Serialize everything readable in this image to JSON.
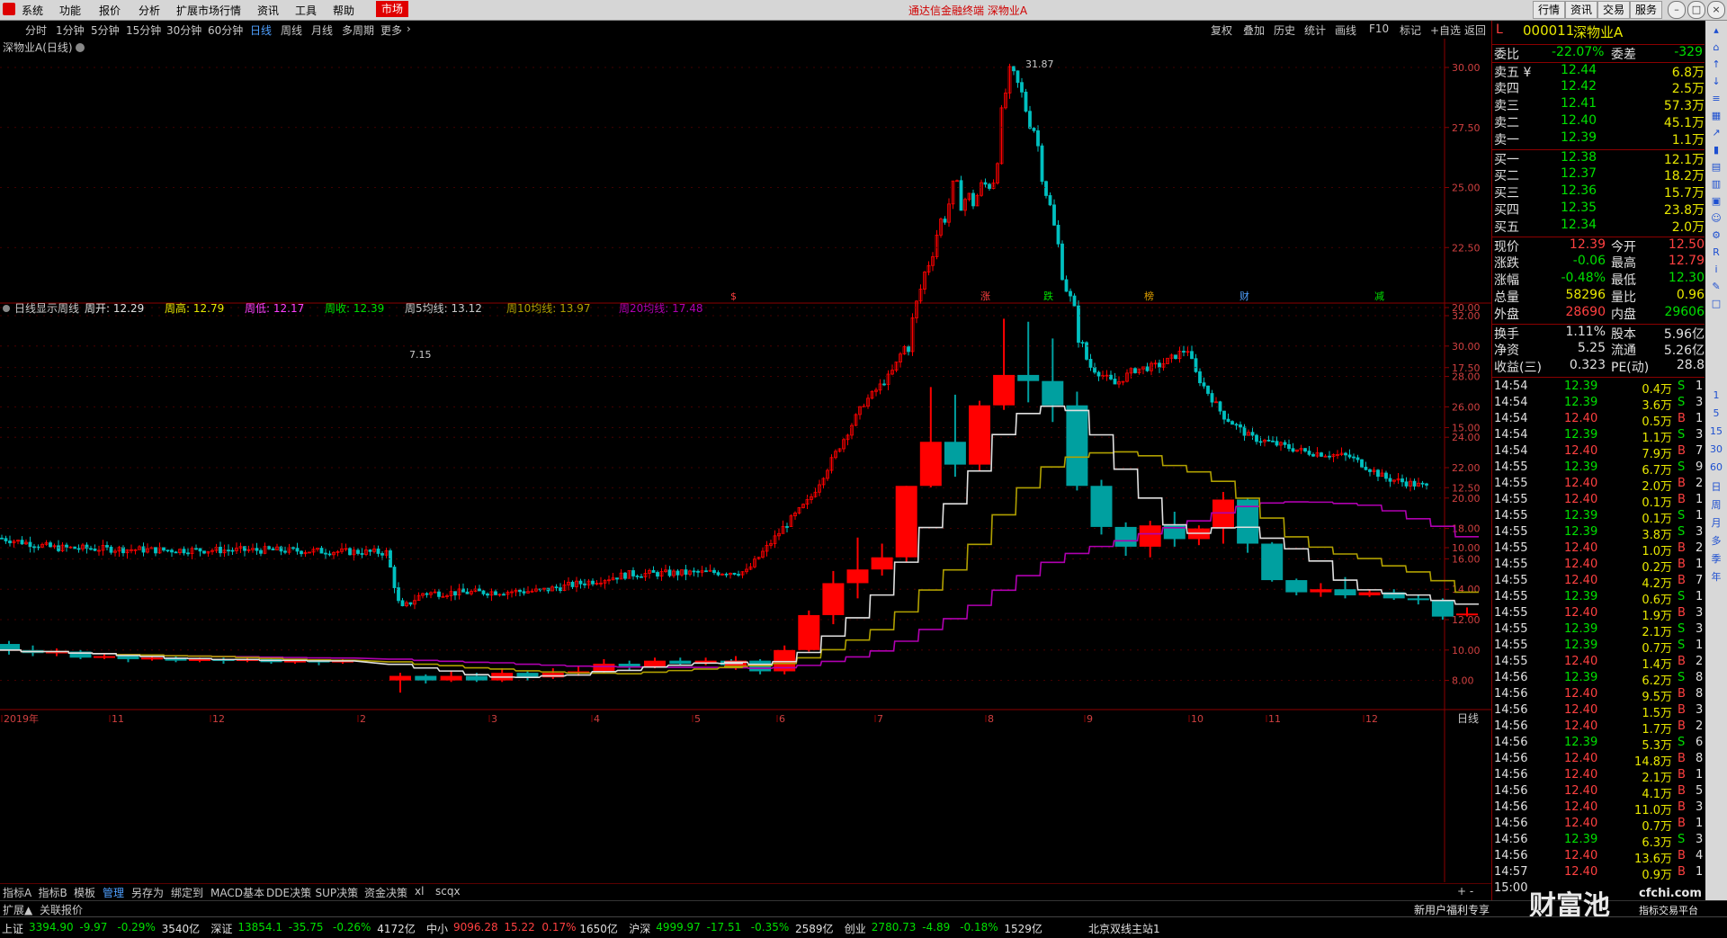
{
  "menubar": {
    "items": [
      "系统",
      "功能",
      "报价",
      "分析",
      "扩展市场行情",
      "资讯",
      "工具",
      "帮助"
    ],
    "market": "市场",
    "app_title": "通达信金融终端  深物业A",
    "right_buttons": [
      "行情",
      "资讯",
      "交易",
      "服务"
    ]
  },
  "toolbar": {
    "periods": [
      "分时",
      "1分钟",
      "5分钟",
      "15分钟",
      "30分钟",
      "60分钟",
      "日线",
      "周线",
      "月线",
      "多周期",
      "更多"
    ],
    "active": "日线",
    "right_items": [
      "复权",
      "叠加",
      "历史",
      "统计",
      "画线",
      "F10",
      "标记",
      "+自选",
      "返回"
    ]
  },
  "main_chart": {
    "title": "深物业A(日线)",
    "high_label": "31.87",
    "low_label": "7.15",
    "y_ticks": [
      "30.00",
      "27.50",
      "25.00",
      "22.50",
      "20.00",
      "17.50",
      "15.00",
      "12.50",
      "10.00"
    ],
    "markers": [
      "$",
      "涨",
      "跌",
      "榜",
      "财",
      "减"
    ]
  },
  "sub_chart": {
    "legend": [
      {
        "label": "日线显示周线",
        "value": "",
        "color": "#c8c8c8"
      },
      {
        "label": "周开: ",
        "value": "12.29",
        "color": "#e0e0e0"
      },
      {
        "label": "周高: ",
        "value": "12.79",
        "color": "#e8e800"
      },
      {
        "label": "周低: ",
        "value": "12.17",
        "color": "#ff40ff"
      },
      {
        "label": "周收: ",
        "value": "12.39",
        "color": "#00e000"
      },
      {
        "label": "周5均线: ",
        "value": "13.12",
        "color": "#c8c8c8"
      },
      {
        "label": "周10均线: ",
        "value": "13.97",
        "color": "#b0a000"
      },
      {
        "label": "周20均线: ",
        "value": "17.48",
        "color": "#b000b0"
      }
    ],
    "y_ticks": [
      "32.00",
      "30.00",
      "28.00",
      "26.00",
      "24.00",
      "22.00",
      "20.00",
      "18.00",
      "16.00",
      "14.00",
      "12.00",
      "10.00",
      "8.00"
    ],
    "x_labels": [
      "2019年",
      "11",
      "12",
      "2",
      "3",
      "4",
      "5",
      "6",
      "7",
      "8",
      "9",
      "10",
      "11",
      "12"
    ],
    "x_range_label": "日线"
  },
  "quote": {
    "code": "000011",
    "name": "深物业A",
    "weibi_label": "委比",
    "weibi": "-22.07%",
    "weicha_label": "委差",
    "weicha": "-329",
    "sells": [
      {
        "label": "卖五 ¥",
        "price": "12.44",
        "vol": "6.8万"
      },
      {
        "label": "卖四",
        "price": "12.42",
        "vol": "2.5万"
      },
      {
        "label": "卖三",
        "price": "12.41",
        "vol": "57.3万"
      },
      {
        "label": "卖二",
        "price": "12.40",
        "vol": "45.1万"
      },
      {
        "label": "卖一",
        "price": "12.39",
        "vol": "1.1万"
      }
    ],
    "buys": [
      {
        "label": "买一",
        "price": "12.38",
        "vol": "12.1万"
      },
      {
        "label": "买二",
        "price": "12.37",
        "vol": "18.2万"
      },
      {
        "label": "买三",
        "price": "12.36",
        "vol": "15.7万"
      },
      {
        "label": "买四",
        "price": "12.35",
        "vol": "23.8万"
      },
      {
        "label": "买五",
        "price": "12.34",
        "vol": "2.0万"
      }
    ],
    "stats": [
      {
        "l1": "现价",
        "v1": "12.39",
        "c1": "red",
        "l2": "今开",
        "v2": "12.50",
        "c2": "red"
      },
      {
        "l1": "涨跌",
        "v1": "-0.06",
        "c1": "green",
        "l2": "最高",
        "v2": "12.79",
        "c2": "red"
      },
      {
        "l1": "涨幅",
        "v1": "-0.48%",
        "c1": "green",
        "l2": "最低",
        "v2": "12.30",
        "c2": "green"
      },
      {
        "l1": "总量",
        "v1": "58296",
        "c1": "yellow",
        "l2": "量比",
        "v2": "0.96",
        "c2": "yellow"
      },
      {
        "l1": "外盘",
        "v1": "28690",
        "c1": "red",
        "l2": "内盘",
        "v2": "29606",
        "c2": "green"
      }
    ],
    "stats2": [
      {
        "l1": "换手",
        "v1": "1.11%",
        "l2": "股本",
        "v2": "5.96亿"
      },
      {
        "l1": "净资",
        "v1": "5.25",
        "l2": "流通",
        "v2": "5.26亿"
      },
      {
        "l1": "收益(三)",
        "v1": "0.323",
        "l2": "PE(动)",
        "v2": "28.8"
      }
    ],
    "ticks": [
      [
        "14:54",
        "12.39",
        "0.4万",
        "S",
        "1"
      ],
      [
        "14:54",
        "12.39",
        "3.6万",
        "S",
        "3"
      ],
      [
        "14:54",
        "12.40",
        "0.5万",
        "B",
        "1"
      ],
      [
        "14:54",
        "12.39",
        "1.1万",
        "S",
        "3"
      ],
      [
        "14:54",
        "12.40",
        "7.9万",
        "B",
        "7"
      ],
      [
        "14:55",
        "12.39",
        "6.7万",
        "S",
        "9"
      ],
      [
        "14:55",
        "12.40",
        "2.0万",
        "B",
        "2"
      ],
      [
        "14:55",
        "12.40",
        "0.1万",
        "B",
        "1"
      ],
      [
        "14:55",
        "12.39",
        "0.1万",
        "S",
        "1"
      ],
      [
        "14:55",
        "12.39",
        "3.8万",
        "S",
        "3"
      ],
      [
        "14:55",
        "12.40",
        "1.0万",
        "B",
        "2"
      ],
      [
        "14:55",
        "12.40",
        "0.2万",
        "B",
        "1"
      ],
      [
        "14:55",
        "12.40",
        "4.2万",
        "B",
        "7"
      ],
      [
        "14:55",
        "12.39",
        "0.6万",
        "S",
        "1"
      ],
      [
        "14:55",
        "12.40",
        "1.9万",
        "B",
        "3"
      ],
      [
        "14:55",
        "12.39",
        "2.1万",
        "S",
        "3"
      ],
      [
        "14:55",
        "12.39",
        "0.7万",
        "S",
        "1"
      ],
      [
        "14:55",
        "12.40",
        "1.4万",
        "B",
        "2"
      ],
      [
        "14:56",
        "12.39",
        "6.2万",
        "S",
        "8"
      ],
      [
        "14:56",
        "12.40",
        "9.5万",
        "B",
        "8"
      ],
      [
        "14:56",
        "12.40",
        "1.5万",
        "B",
        "3"
      ],
      [
        "14:56",
        "12.40",
        "1.7万",
        "B",
        "2"
      ],
      [
        "14:56",
        "12.39",
        "5.3万",
        "S",
        "6"
      ],
      [
        "14:56",
        "12.40",
        "14.8万",
        "B",
        "8"
      ],
      [
        "14:56",
        "12.40",
        "2.1万",
        "B",
        "1"
      ],
      [
        "14:56",
        "12.40",
        "4.1万",
        "B",
        "5"
      ],
      [
        "14:56",
        "12.40",
        "11.0万",
        "B",
        "3"
      ],
      [
        "14:56",
        "12.40",
        "0.7万",
        "B",
        "1"
      ],
      [
        "14:56",
        "12.39",
        "6.3万",
        "S",
        "3"
      ],
      [
        "14:56",
        "12.40",
        "13.6万",
        "B",
        "4"
      ],
      [
        "14:57",
        "12.40",
        "0.9万",
        "B",
        "1"
      ]
    ],
    "last_time": "15:00"
  },
  "sidebar_labels": [
    "1",
    "5",
    "15",
    "30",
    "60",
    "日",
    "周",
    "月",
    "多",
    "季",
    "年"
  ],
  "tabs": {
    "items": [
      "指标A",
      "指标B",
      "模板",
      "管理",
      "另存为",
      "绑定到",
      "MACD基本",
      "DDE决策",
      "SUP决策",
      "资金决策",
      "xl",
      "scqx"
    ],
    "active": "管理"
  },
  "expbar": {
    "items": [
      "扩展▲",
      "关联报价"
    ],
    "promo": "新用户福利专享",
    "brand": "财富池",
    "brand_url": "cfchi.com",
    "brand_sub": "指标交易平台"
  },
  "status": [
    {
      "name": "上证",
      "price": "3394.90",
      "chg": "-9.97",
      "pct": "-0.29%",
      "amt": "3540亿"
    },
    {
      "name": "深证",
      "price": "13854.1",
      "chg": "-35.75",
      "pct": "-0.26%",
      "amt": "4172亿"
    },
    {
      "name": "中小",
      "price": "9096.28",
      "chg": "15.22",
      "pct": "0.17%",
      "amt": "1650亿"
    },
    {
      "name": "沪深",
      "price": "4999.97",
      "chg": "-17.51",
      "pct": "-0.35%",
      "amt": "2589亿"
    },
    {
      "name": "创业",
      "price": "2780.73",
      "chg": "-4.89",
      "pct": "-0.18%",
      "amt": "1529亿"
    }
  ],
  "server": "北京双线主站1",
  "colors": {
    "up": "#ff0000",
    "down": "#00a0a0",
    "ma5": "#e0e0e0",
    "ma10": "#b0a000",
    "ma20": "#b000b0",
    "grid": "#5a0000",
    "axis": "#8b0000"
  }
}
